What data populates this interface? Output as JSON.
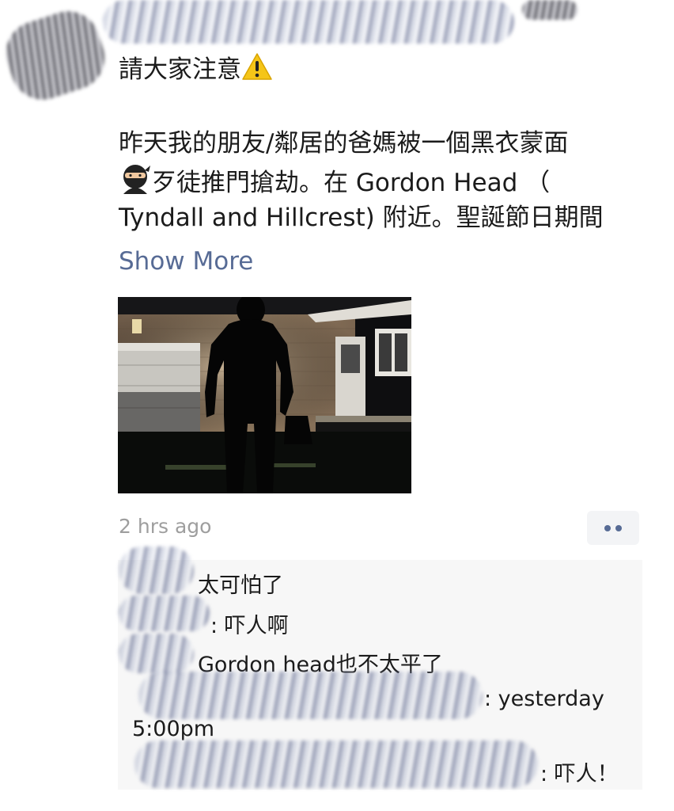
{
  "post": {
    "heading": "請大家注意",
    "warning_emoji": "⚠",
    "line1": "昨天我的朋友/鄰居的爸媽被一個黑衣蒙面",
    "line2_text": "歹徒推門搶劫。在 Gordon Head （",
    "ninja_emoji": "ninja-icon",
    "line3": "Tyndall and Hillcrest) 附近。聖誕節日期間",
    "show_more": "Show More",
    "timestamp": "2 hrs ago"
  },
  "comments": [
    {
      "name": "",
      "text": "太可怕了"
    },
    {
      "name": "",
      "text": ": 吓人啊"
    },
    {
      "name": "",
      "text": "Gordon head也不太平了"
    },
    {
      "name": "",
      "text": ": yesterday"
    },
    {
      "name": "",
      "text": "5:00pm"
    },
    {
      "name": "",
      "text": ": 吓人！"
    }
  ],
  "colors": {
    "link": "#576b95",
    "timestamp": "#9e9e9e",
    "comment_bg": "#f7f7f7"
  }
}
